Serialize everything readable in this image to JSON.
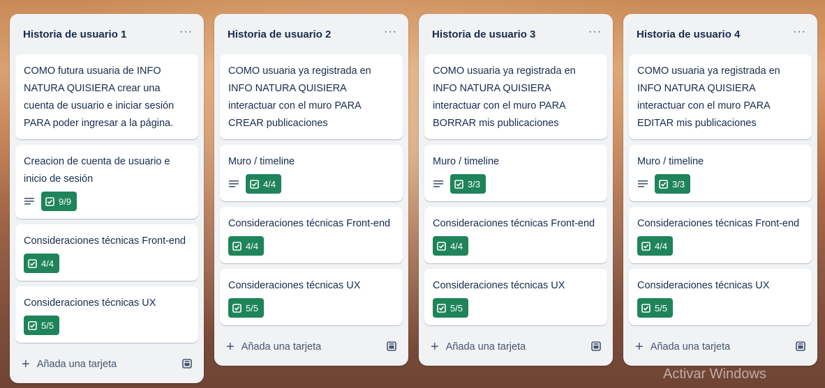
{
  "lists": [
    {
      "title": "Historia de usuario 1",
      "menu": "···",
      "cards": [
        {
          "text": "COMO futura usuaria de INFO NATURA QUISIERA crear una cuenta de usuario e iniciar sesión PARA poder ingresar a la página."
        },
        {
          "text": "Creacion de cuenta de usuario e inicio de sesión",
          "description": true,
          "checklist": "9/9"
        },
        {
          "text": "Consideraciones técnicas Front-end",
          "checklist": "4/4"
        },
        {
          "text": "Consideraciones técnicas UX",
          "checklist": "5/5"
        }
      ],
      "add_label": "Añada una tarjeta"
    },
    {
      "title": "Historia de usuario 2",
      "menu": "···",
      "cards": [
        {
          "text": "COMO usuaria ya registrada en INFO NATURA QUISIERA interactuar con el muro PARA CREAR publicaciones"
        },
        {
          "text": "Muro / timeline",
          "description": true,
          "checklist": "4/4"
        },
        {
          "text": "Consideraciones técnicas Front-end",
          "checklist": "4/4"
        },
        {
          "text": "Consideraciones técnicas UX",
          "checklist": "5/5"
        }
      ],
      "add_label": "Añada una tarjeta"
    },
    {
      "title": "Historia de usuario 3",
      "menu": "···",
      "cards": [
        {
          "text": "COMO usuaria ya registrada en INFO NATURA QUISIERA interactuar con el muro PARA BORRAR mis publicaciones"
        },
        {
          "text": "Muro / timeline",
          "description": true,
          "checklist": "3/3"
        },
        {
          "text": "Consideraciones técnicas Front-end",
          "checklist": "4/4"
        },
        {
          "text": "Consideraciones técnicas UX",
          "checklist": "5/5"
        }
      ],
      "add_label": "Añada una tarjeta"
    },
    {
      "title": "Historia de usuario 4",
      "menu": "···",
      "cards": [
        {
          "text": "COMO usuaria ya registrada en INFO NATURA QUISIERA interactuar con el muro PARA EDITAR mis publicaciones"
        },
        {
          "text": "Muro / timeline",
          "description": true,
          "checklist": "3/3"
        },
        {
          "text": "Consideraciones técnicas Front-end",
          "checklist": "4/4"
        },
        {
          "text": "Consideraciones técnicas UX",
          "checklist": "5/5"
        }
      ],
      "add_label": "Añada una tarjeta"
    }
  ],
  "watermark": "Activar Windows",
  "colors": {
    "badge_green": "#1f845a",
    "list_bg": "#f1f2f4"
  }
}
